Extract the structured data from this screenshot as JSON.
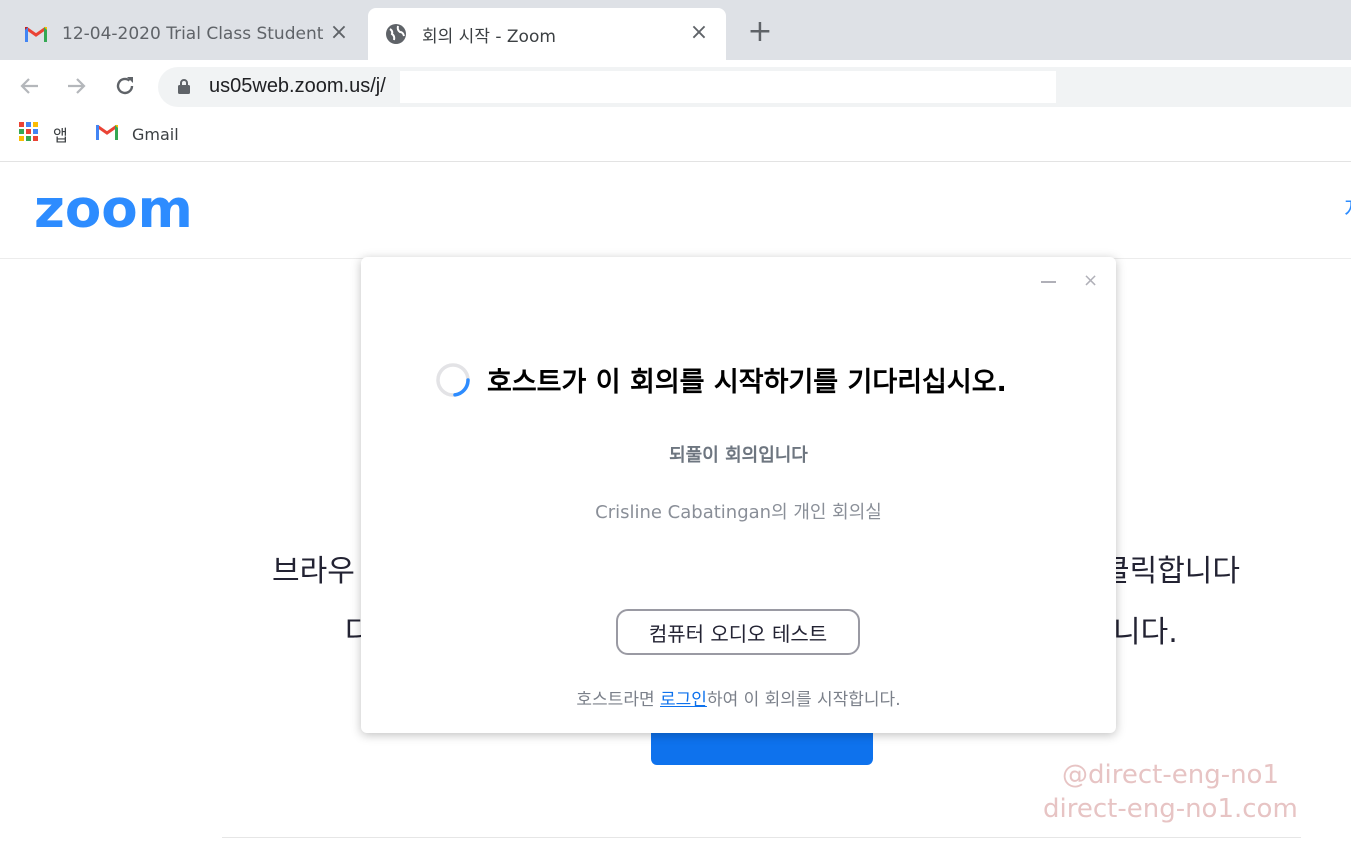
{
  "browser": {
    "tabs": [
      {
        "title": "12-04-2020 Trial Class Student /",
        "icon": "gmail-icon",
        "active": false
      },
      {
        "title": "회의 시작 - Zoom",
        "icon": "globe-icon",
        "active": true
      }
    ],
    "new_tab_label": "+",
    "close_label": "×",
    "address": "us05web.zoom.us/j/",
    "bookmarks": [
      {
        "label": "앱",
        "icon": "apps-grid-icon"
      },
      {
        "label": "Gmail",
        "icon": "gmail-icon"
      }
    ]
  },
  "page": {
    "logo": "zoom",
    "header_link_partial": "지",
    "background": {
      "line1_left": "브라우",
      "line1_right": "클릭합니다",
      "line2_left": "다",
      "line2_right": "니다."
    }
  },
  "dialog": {
    "title": "호스트가 이 회의를 시작하기를 기다리십시오.",
    "meeting_topic": "되풀이 회의입니다",
    "meeting_room": "Crisline Cabatingan의 개인 회의실",
    "audio_test_button": "컴퓨터 오디오 테스트",
    "footer_prefix": "호스트라면 ",
    "footer_link": "로그인",
    "footer_suffix": "하여 이 회의를 시작합니다.",
    "close_label": "×"
  },
  "watermark": {
    "line1": "@direct-eng-no1",
    "line2": "direct-eng-no1.com"
  },
  "colors": {
    "zoom_blue": "#2d8cff",
    "button_blue": "#0e72ed",
    "tab_strip": "#dee1e6"
  }
}
